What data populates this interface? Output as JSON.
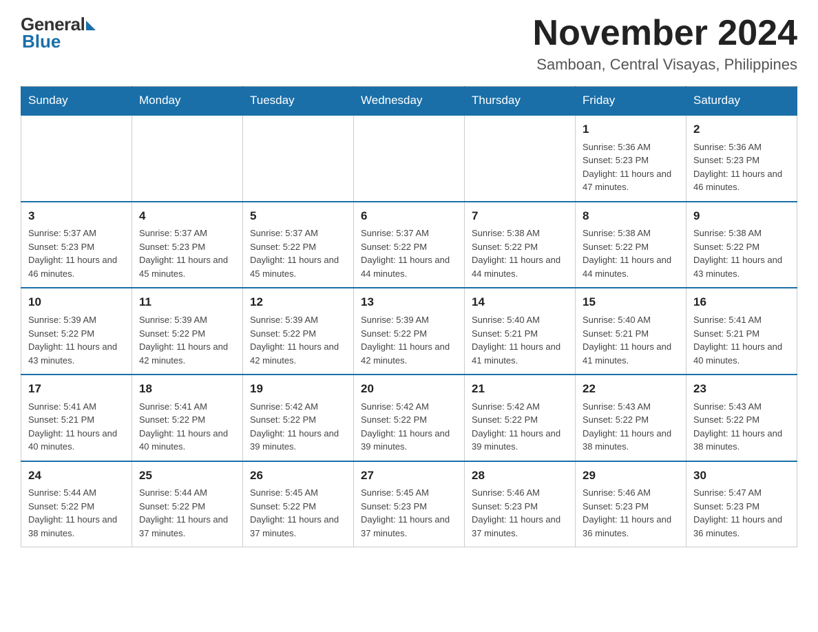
{
  "logo": {
    "general": "General",
    "blue": "Blue"
  },
  "header": {
    "month": "November 2024",
    "location": "Samboan, Central Visayas, Philippines"
  },
  "days_of_week": [
    "Sunday",
    "Monday",
    "Tuesday",
    "Wednesday",
    "Thursday",
    "Friday",
    "Saturday"
  ],
  "weeks": [
    [
      {
        "day": "",
        "info": ""
      },
      {
        "day": "",
        "info": ""
      },
      {
        "day": "",
        "info": ""
      },
      {
        "day": "",
        "info": ""
      },
      {
        "day": "",
        "info": ""
      },
      {
        "day": "1",
        "info": "Sunrise: 5:36 AM\nSunset: 5:23 PM\nDaylight: 11 hours and 47 minutes."
      },
      {
        "day": "2",
        "info": "Sunrise: 5:36 AM\nSunset: 5:23 PM\nDaylight: 11 hours and 46 minutes."
      }
    ],
    [
      {
        "day": "3",
        "info": "Sunrise: 5:37 AM\nSunset: 5:23 PM\nDaylight: 11 hours and 46 minutes."
      },
      {
        "day": "4",
        "info": "Sunrise: 5:37 AM\nSunset: 5:23 PM\nDaylight: 11 hours and 45 minutes."
      },
      {
        "day": "5",
        "info": "Sunrise: 5:37 AM\nSunset: 5:22 PM\nDaylight: 11 hours and 45 minutes."
      },
      {
        "day": "6",
        "info": "Sunrise: 5:37 AM\nSunset: 5:22 PM\nDaylight: 11 hours and 44 minutes."
      },
      {
        "day": "7",
        "info": "Sunrise: 5:38 AM\nSunset: 5:22 PM\nDaylight: 11 hours and 44 minutes."
      },
      {
        "day": "8",
        "info": "Sunrise: 5:38 AM\nSunset: 5:22 PM\nDaylight: 11 hours and 44 minutes."
      },
      {
        "day": "9",
        "info": "Sunrise: 5:38 AM\nSunset: 5:22 PM\nDaylight: 11 hours and 43 minutes."
      }
    ],
    [
      {
        "day": "10",
        "info": "Sunrise: 5:39 AM\nSunset: 5:22 PM\nDaylight: 11 hours and 43 minutes."
      },
      {
        "day": "11",
        "info": "Sunrise: 5:39 AM\nSunset: 5:22 PM\nDaylight: 11 hours and 42 minutes."
      },
      {
        "day": "12",
        "info": "Sunrise: 5:39 AM\nSunset: 5:22 PM\nDaylight: 11 hours and 42 minutes."
      },
      {
        "day": "13",
        "info": "Sunrise: 5:39 AM\nSunset: 5:22 PM\nDaylight: 11 hours and 42 minutes."
      },
      {
        "day": "14",
        "info": "Sunrise: 5:40 AM\nSunset: 5:21 PM\nDaylight: 11 hours and 41 minutes."
      },
      {
        "day": "15",
        "info": "Sunrise: 5:40 AM\nSunset: 5:21 PM\nDaylight: 11 hours and 41 minutes."
      },
      {
        "day": "16",
        "info": "Sunrise: 5:41 AM\nSunset: 5:21 PM\nDaylight: 11 hours and 40 minutes."
      }
    ],
    [
      {
        "day": "17",
        "info": "Sunrise: 5:41 AM\nSunset: 5:21 PM\nDaylight: 11 hours and 40 minutes."
      },
      {
        "day": "18",
        "info": "Sunrise: 5:41 AM\nSunset: 5:22 PM\nDaylight: 11 hours and 40 minutes."
      },
      {
        "day": "19",
        "info": "Sunrise: 5:42 AM\nSunset: 5:22 PM\nDaylight: 11 hours and 39 minutes."
      },
      {
        "day": "20",
        "info": "Sunrise: 5:42 AM\nSunset: 5:22 PM\nDaylight: 11 hours and 39 minutes."
      },
      {
        "day": "21",
        "info": "Sunrise: 5:42 AM\nSunset: 5:22 PM\nDaylight: 11 hours and 39 minutes."
      },
      {
        "day": "22",
        "info": "Sunrise: 5:43 AM\nSunset: 5:22 PM\nDaylight: 11 hours and 38 minutes."
      },
      {
        "day": "23",
        "info": "Sunrise: 5:43 AM\nSunset: 5:22 PM\nDaylight: 11 hours and 38 minutes."
      }
    ],
    [
      {
        "day": "24",
        "info": "Sunrise: 5:44 AM\nSunset: 5:22 PM\nDaylight: 11 hours and 38 minutes."
      },
      {
        "day": "25",
        "info": "Sunrise: 5:44 AM\nSunset: 5:22 PM\nDaylight: 11 hours and 37 minutes."
      },
      {
        "day": "26",
        "info": "Sunrise: 5:45 AM\nSunset: 5:22 PM\nDaylight: 11 hours and 37 minutes."
      },
      {
        "day": "27",
        "info": "Sunrise: 5:45 AM\nSunset: 5:23 PM\nDaylight: 11 hours and 37 minutes."
      },
      {
        "day": "28",
        "info": "Sunrise: 5:46 AM\nSunset: 5:23 PM\nDaylight: 11 hours and 37 minutes."
      },
      {
        "day": "29",
        "info": "Sunrise: 5:46 AM\nSunset: 5:23 PM\nDaylight: 11 hours and 36 minutes."
      },
      {
        "day": "30",
        "info": "Sunrise: 5:47 AM\nSunset: 5:23 PM\nDaylight: 11 hours and 36 minutes."
      }
    ]
  ]
}
